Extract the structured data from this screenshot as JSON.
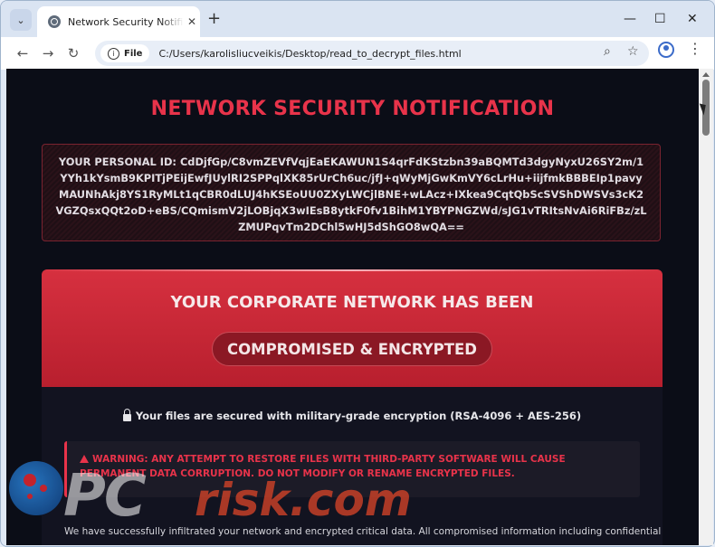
{
  "browser": {
    "tab_title": "Network Security Notification &",
    "tab_close": "✕",
    "new_tab": "+",
    "file_label": "File",
    "url": "C:/Users/karolisliucveikis/Desktop/read_to_decrypt_files.html",
    "window_min": "—",
    "window_max": "☐",
    "window_close": "✕"
  },
  "page": {
    "title": "NETWORK SECURITY NOTIFICATION",
    "personal_id": "YOUR PERSONAL ID: CdDjfGp/C8vmZEVfVqjEaEKAWUN1S4qrFdKStzbn39aBQMTd3dgyNyxU26SY2m/1YYh1kYsmB9KPITjPEijEwfJUylRI2SPPqlXK85rUrCh6uc/jfJ+qWyMjGwKmVY6cLrHu+iijfmkBBBEIp1pavyMAUNhAkj8YS1RyMLt1qCBR0dLUJ4hKSEoUU0ZXyLWCjlBNE+wLAcz+IXkea9CqtQbScSVShDWSVs3cK2VGZQsxQQt2oD+eBS/CQmismV2jLOBjqX3wIEsB8ytkF0fv1BihM1YBYPNGZWd/sJG1vTRItsNvAi6RiFBz/zLZMUPqvTm2DChl5wHJ5dShGO8wQA==",
    "header_line": "YOUR CORPORATE NETWORK HAS BEEN",
    "header_pill": "COMPROMISED & ENCRYPTED",
    "secured_text": "Your files are secured with military-grade encryption (RSA-4096 + AES-256)",
    "warning_text": "WARNING: ANY ATTEMPT TO RESTORE FILES WITH THIRD-PARTY SOFTWARE WILL CAUSE PERMANENT DATA CORRUPTION. DO NOT MODIFY OR RENAME ENCRYPTED FILES.",
    "body_text": "We have successfully infiltrated your network and encrypted critical data. All compromised information including confidential"
  },
  "watermark": {
    "text_pc": "PC",
    "text_risk": "risk.com"
  },
  "colors": {
    "accent_red": "#e8334a",
    "page_bg": "#0b0d17"
  }
}
